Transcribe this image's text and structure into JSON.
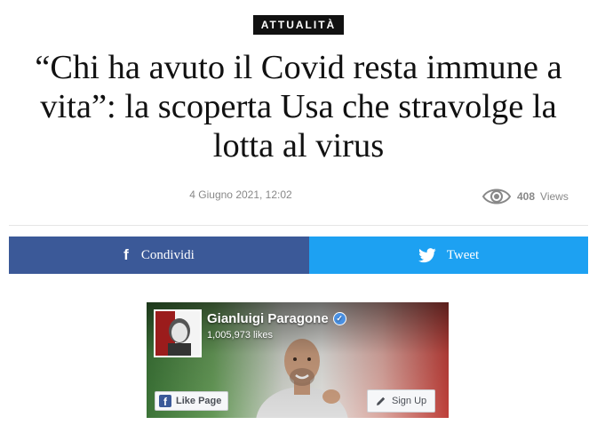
{
  "article": {
    "category": "ATTUALITÀ",
    "headline": "“Chi ha avuto il Covid resta immune a vita”: la scoperta Usa che stravolge la lotta al virus",
    "date": "4 Giugno 2021, 12:02",
    "views_count": "408",
    "views_label": "Views"
  },
  "share": {
    "facebook_label": "Condividi",
    "facebook_icon": "f",
    "twitter_label": "Tweet",
    "facebook_color": "#3b5998",
    "twitter_color": "#1da1f2"
  },
  "fb_widget": {
    "page_name": "Gianluigi Paragone",
    "likes": "1,005,973 likes",
    "like_page_label": "Like Page",
    "sign_up_label": "Sign Up",
    "like_icon": "f",
    "verified_icon": "✓"
  }
}
